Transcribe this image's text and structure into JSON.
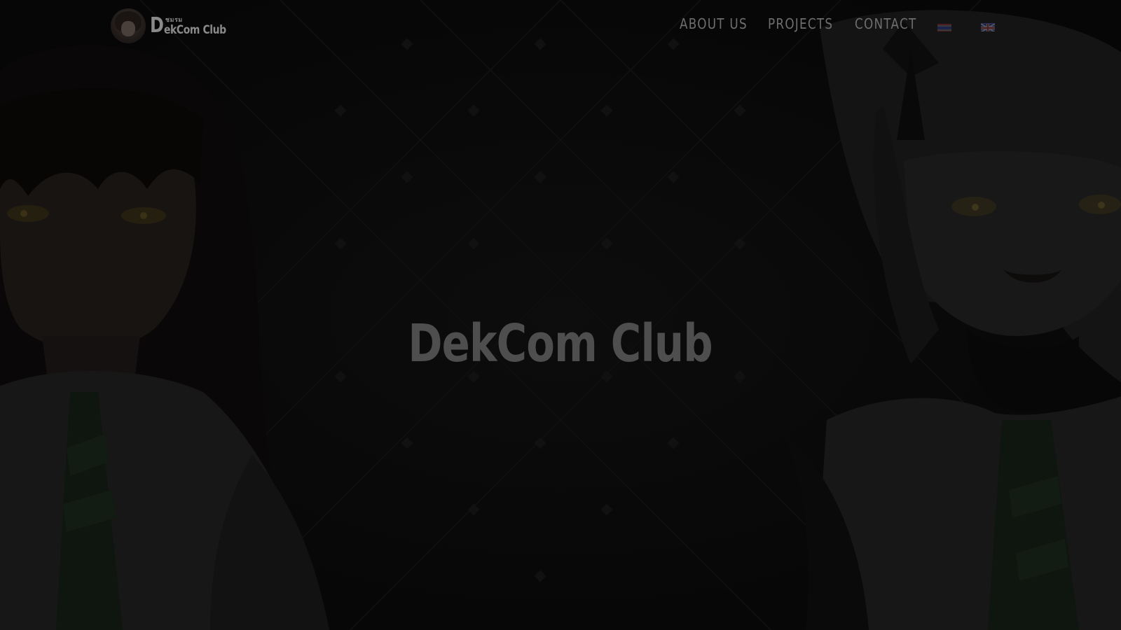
{
  "header": {
    "logo": {
      "letter": "D",
      "small_text": "ชมรม",
      "name": "ekCom Club"
    },
    "nav": [
      {
        "label": "ABOUT US"
      },
      {
        "label": "PROJECTS"
      },
      {
        "label": "CONTACT"
      }
    ],
    "languages": [
      {
        "icon": "thai-flag-icon"
      },
      {
        "icon": "uk-flag-icon"
      }
    ]
  },
  "hero": {
    "title": "DekCom Club"
  },
  "colors": {
    "background": "#0d0d0d",
    "nav_text": "#6e6e6e",
    "title_text": "#4e4e4e"
  }
}
